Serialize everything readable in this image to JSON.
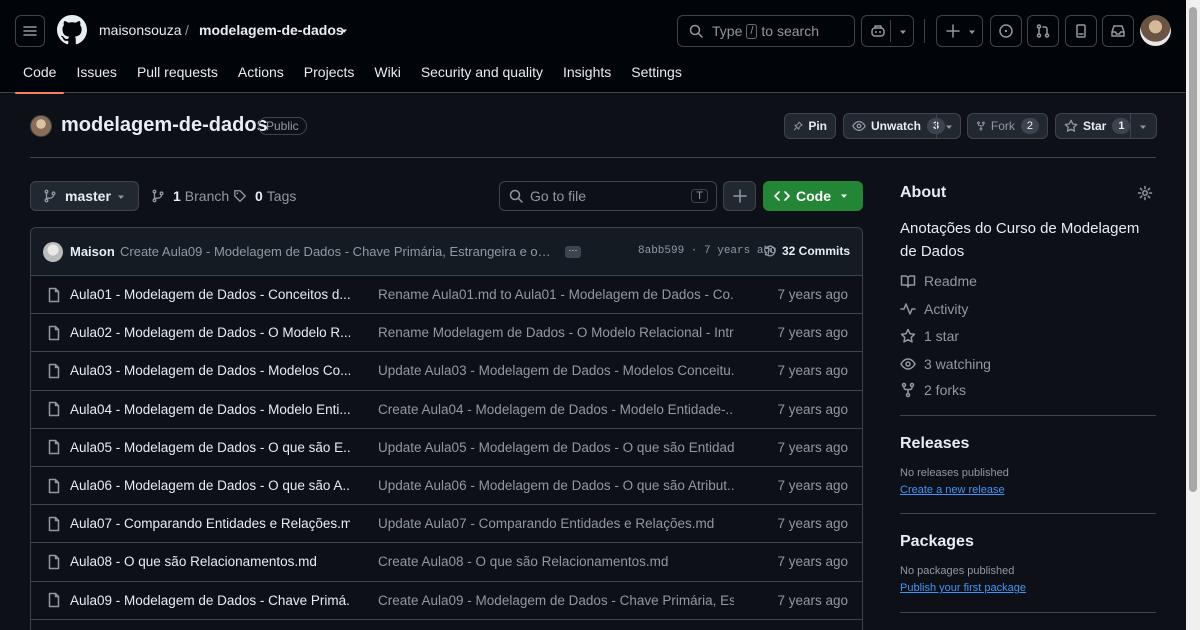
{
  "header": {
    "owner": "maisonsouza",
    "separator": "/",
    "repo": "modelagem-de-dados",
    "search": {
      "prefix": "Type",
      "key": "/",
      "suffix": "to search"
    },
    "tabs": [
      {
        "label": "Code",
        "active": true
      },
      {
        "label": "Issues"
      },
      {
        "label": "Pull requests"
      },
      {
        "label": "Actions"
      },
      {
        "label": "Projects"
      },
      {
        "label": "Wiki"
      },
      {
        "label": "Security and quality"
      },
      {
        "label": "Insights"
      },
      {
        "label": "Settings"
      }
    ]
  },
  "repo": {
    "name": "modelagem-de-dados",
    "visibility": "Public",
    "pin_label": "Pin",
    "unwatch_label": "Unwatch",
    "watch_count": "3",
    "fork_label": "Fork",
    "fork_count": "2",
    "star_label": "Star",
    "star_count": "1"
  },
  "filenav": {
    "branch": "master",
    "branches_count": "1",
    "branches_label": "Branch",
    "tags_count": "0",
    "tags_label": "Tags",
    "goto_placeholder": "Go to file",
    "goto_key": "T",
    "code_label": "Code"
  },
  "latest_commit": {
    "author": "Maison",
    "message": "Create Aula09 - Modelagem de Dados - Chave Primária, Estrangeira e outras",
    "sha_time": "8abb599 · 7 years ago",
    "commits_label": "32 Commits"
  },
  "files": [
    {
      "name": "Aula01 - Modelagem de Dados - Conceitos d...",
      "message": "Rename Aula01.md to Aula01 - Modelagem de Dados - Co...",
      "date": "7 years ago"
    },
    {
      "name": "Aula02 - Modelagem de Dados - O Modelo R...",
      "message": "Rename Modelagem de Dados - O Modelo Relacional - Intr...",
      "date": "7 years ago"
    },
    {
      "name": "Aula03 - Modelagem de Dados - Modelos Co...",
      "message": "Update Aula03 - Modelagem de Dados - Modelos Conceitu...",
      "date": "7 years ago"
    },
    {
      "name": "Aula04 - Modelagem de Dados - Modelo Enti...",
      "message": "Create Aula04 - Modelagem de Dados - Modelo Entidade-...",
      "date": "7 years ago"
    },
    {
      "name": "Aula05 - Modelagem de Dados - O que são E...",
      "message": "Update Aula05 - Modelagem de Dados - O que são Entidad...",
      "date": "7 years ago"
    },
    {
      "name": "Aula06 - Modelagem de Dados - O que são A...",
      "message": "Update Aula06 - Modelagem de Dados - O que são Atribut...",
      "date": "7 years ago"
    },
    {
      "name": "Aula07 - Comparando Entidades e Relações.md",
      "message": "Update Aula07 - Comparando Entidades e Relações.md",
      "date": "7 years ago"
    },
    {
      "name": "Aula08 - O que são Relacionamentos.md",
      "message": "Create Aula08 - O que são Relacionamentos.md",
      "date": "7 years ago"
    },
    {
      "name": "Aula09 - Modelagem de Dados - Chave Primá...",
      "message": "Create Aula09 - Modelagem de Dados - Chave Primária, Est...",
      "date": "7 years ago"
    }
  ],
  "sidebar": {
    "about_title": "About",
    "description": "Anotações do Curso de Modelagem de Dados",
    "readme": "Readme",
    "activity": "Activity",
    "stars": "1 star",
    "watching": "3 watching",
    "forks": "2 forks",
    "releases_title": "Releases",
    "releases_empty": "No releases published",
    "releases_link": "Create a new release",
    "packages_title": "Packages",
    "packages_empty": "No packages published",
    "packages_link": "Publish your first package"
  },
  "colors": {
    "accent_tab": "#f78166",
    "code_button": "#238636",
    "link": "#4493f8",
    "background": "#0d1117"
  }
}
